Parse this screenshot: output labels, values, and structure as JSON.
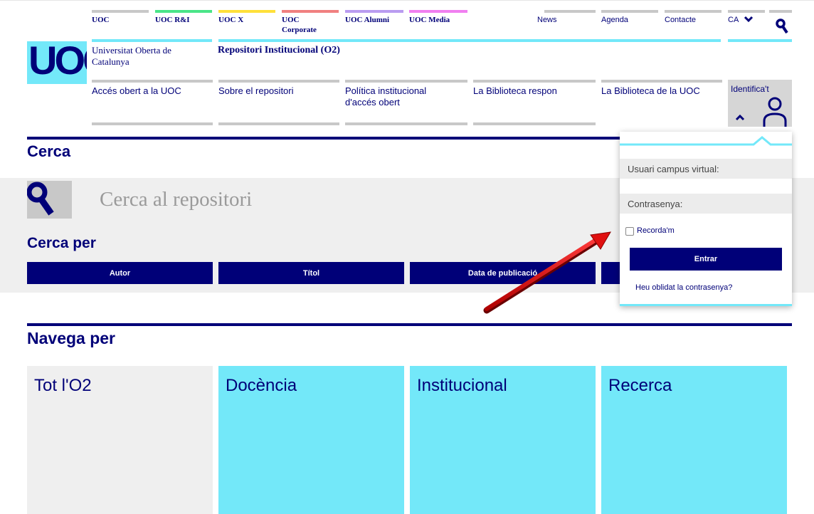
{
  "top_nav": {
    "items": [
      {
        "label": "UOC",
        "accent": "#c8c8c8"
      },
      {
        "label": "UOC R&I",
        "accent": "#4ae588"
      },
      {
        "label": "UOC X",
        "accent": "#ffe03a"
      },
      {
        "label": "UOC Corporate",
        "accent": "#f08080"
      },
      {
        "label": "UOC Alumni",
        "accent": "#b99cf0"
      },
      {
        "label": "UOC Media",
        "accent": "#f07ff0"
      }
    ],
    "news": "News",
    "agenda": "Agenda",
    "contacte": "Contacte",
    "language": "CA",
    "language_icon": "chevron-down-icon",
    "search_icon": "search-icon"
  },
  "brand": {
    "logo_text": "UOC",
    "university_name": "Universitat Oberta de Catalunya",
    "repository_name": "Repositori Institucional (O2)"
  },
  "sec_nav": {
    "items": [
      "Accés obert a la UOC",
      "Sobre el repositori",
      "Política institucional d'accés obert",
      "La Biblioteca respon",
      "La Biblioteca de la UOC"
    ],
    "identify_label": "Identifica't",
    "user_icon": "user-icon",
    "caret_icon": "chevron-up-icon"
  },
  "search": {
    "heading": "Cerca",
    "placeholder": "Cerca al repositori",
    "search_by_heading": "Cerca per",
    "buttons": [
      "Autor",
      "Títol",
      "Data de publicació"
    ]
  },
  "browse": {
    "heading": "Navega per",
    "tiles": [
      {
        "label": "Tot l'O2",
        "color": "#efefef"
      },
      {
        "label": "Docència",
        "color": "#73e8f9"
      },
      {
        "label": "Institucional",
        "color": "#73e8f9"
      },
      {
        "label": "Recerca",
        "color": "#73e8f9"
      }
    ]
  },
  "login": {
    "username_placeholder": "Usuari campus virtual:",
    "password_placeholder": "Contrasenya:",
    "remember_label": "Recorda'm",
    "enter_label": "Entrar",
    "forgot_link": "Heu oblidat la contrasenya?"
  },
  "colors": {
    "brand_navy": "#000078",
    "brand_cyan": "#73e8f9",
    "arrow_red": "#e01010"
  }
}
